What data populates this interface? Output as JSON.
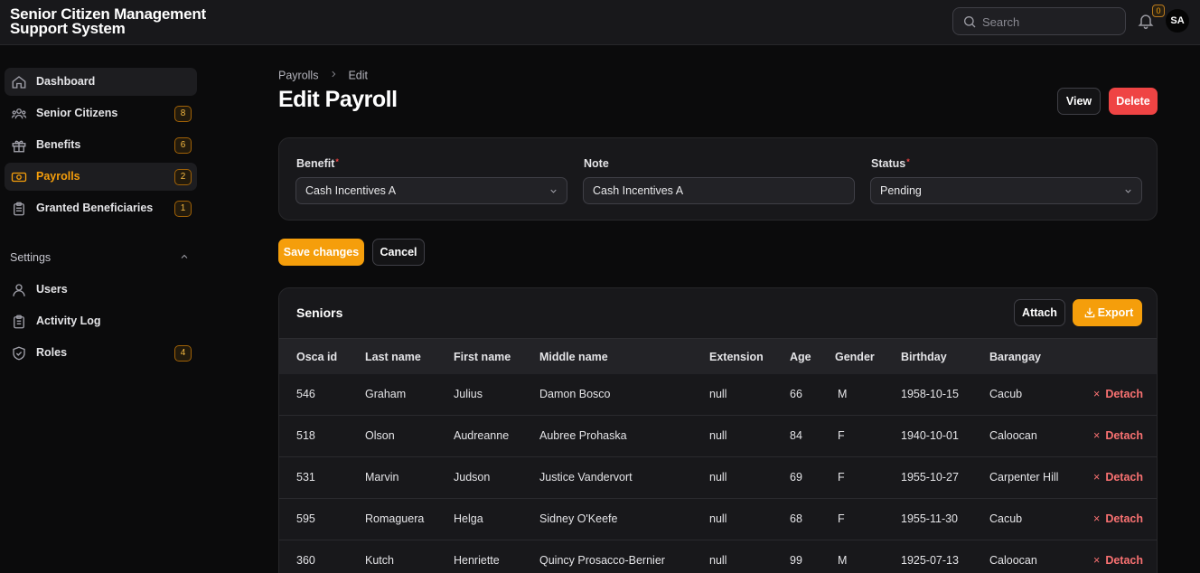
{
  "app": {
    "title": "Senior Citizen Management Support System"
  },
  "topbar": {
    "search_placeholder": "Search",
    "notifications_count": "0",
    "avatar_initials": "SA"
  },
  "sidebar": {
    "items": [
      {
        "label": "Dashboard",
        "icon": "home-icon"
      },
      {
        "label": "Senior Citizens",
        "icon": "users-icon",
        "badge": "8"
      },
      {
        "label": "Benefits",
        "icon": "gift-icon",
        "badge": "6"
      },
      {
        "label": "Payrolls",
        "icon": "banknote-icon",
        "badge": "2"
      },
      {
        "label": "Granted Beneficiaries",
        "icon": "clipboard-icon",
        "badge": "1"
      }
    ],
    "settings_label": "Settings",
    "settings_items": [
      {
        "label": "Users",
        "icon": "user-icon"
      },
      {
        "label": "Activity Log",
        "icon": "clipboard-list-icon"
      },
      {
        "label": "Roles",
        "icon": "shield-check-icon",
        "badge": "4"
      }
    ]
  },
  "breadcrumb": {
    "parent": "Payrolls",
    "current": "Edit"
  },
  "page": {
    "title": "Edit Payroll",
    "view_label": "View",
    "delete_label": "Delete"
  },
  "form": {
    "benefit_label": "Benefit",
    "benefit_value": "Cash Incentives A",
    "note_label": "Note",
    "note_value": "Cash Incentives A",
    "status_label": "Status",
    "status_value": "Pending",
    "required_mark": "*"
  },
  "actions": {
    "save_label": "Save changes",
    "cancel_label": "Cancel"
  },
  "seniors": {
    "title": "Seniors",
    "attach_label": "Attach",
    "export_label": "Export",
    "detach_label": "Detach",
    "columns": [
      "Osca id",
      "Last name",
      "First name",
      "Middle name",
      "Extension",
      "Age",
      "Gender",
      "Birthday",
      "Barangay"
    ],
    "rows": [
      [
        "546",
        "Graham",
        "Julius",
        "Damon Bosco",
        "null",
        "66",
        "M",
        "1958-10-15",
        "Cacub"
      ],
      [
        "518",
        "Olson",
        "Audreanne",
        "Aubree Prohaska",
        "null",
        "84",
        "F",
        "1940-10-01",
        "Caloocan"
      ],
      [
        "531",
        "Marvin",
        "Judson",
        "Justice Vandervort",
        "null",
        "69",
        "F",
        "1955-10-27",
        "Carpenter Hill"
      ],
      [
        "595",
        "Romaguera",
        "Helga",
        "Sidney O'Keefe",
        "null",
        "68",
        "F",
        "1955-11-30",
        "Cacub"
      ],
      [
        "360",
        "Kutch",
        "Henriette",
        "Quincy Prosacco-Bernier",
        "null",
        "99",
        "M",
        "1925-07-13",
        "Caloocan"
      ]
    ]
  },
  "colors": {
    "accent": "#f59e0b",
    "danger": "#ef4444",
    "background": "#0b0b0c",
    "card": "#18181b"
  }
}
